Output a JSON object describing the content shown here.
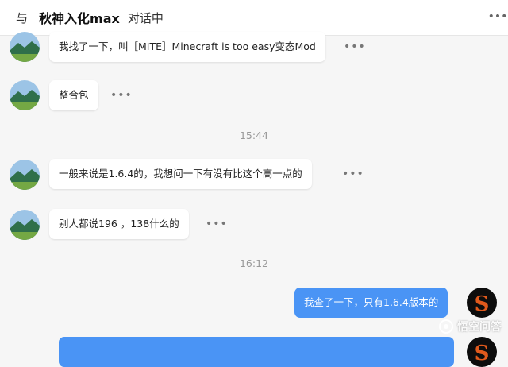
{
  "header": {
    "prefix": "与",
    "contact_name": "秋神入化max",
    "suffix": "对话中",
    "more_icon": "more-dots-icon"
  },
  "messages": [
    {
      "type": "message",
      "sender": "other",
      "text": "我找了一下，叫［MITE］Minecraft is too easy变态Mod"
    },
    {
      "type": "message",
      "sender": "other",
      "text": "整合包"
    },
    {
      "type": "timestamp",
      "text": "15:44"
    },
    {
      "type": "message",
      "sender": "other",
      "text": "一般来说是1.6.4的，我想问一下有没有比这个高一点的"
    },
    {
      "type": "message",
      "sender": "other",
      "text": "别人都说196 ，138什么的"
    },
    {
      "type": "timestamp",
      "text": "16:12"
    },
    {
      "type": "message",
      "sender": "me",
      "text": "我查了一下，只有1.6.4版本的"
    },
    {
      "type": "message",
      "sender": "me",
      "text": ""
    }
  ],
  "colors": {
    "my_bubble": "#4a94f5",
    "other_bubble": "#ffffff",
    "background": "#f6f6f6"
  },
  "watermark": {
    "text": "悟空问答",
    "icon": "wukong-logo-icon"
  }
}
